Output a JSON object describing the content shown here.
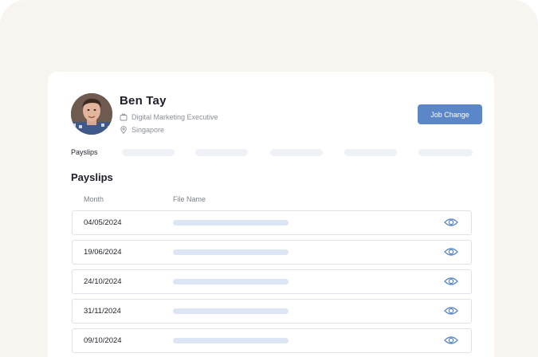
{
  "profile": {
    "name": "Ben Tay",
    "job_title": "Digital Marketing Executive",
    "location": "Singapore"
  },
  "actions": {
    "job_change_label": "Job Change"
  },
  "tabs": {
    "active_label": "Payslips"
  },
  "payslips": {
    "title": "Payslips",
    "columns": {
      "month": "Month",
      "file_name": "File Name"
    },
    "rows": [
      {
        "month": "04/05/2024"
      },
      {
        "month": "19/06/2024"
      },
      {
        "month": "24/10/2024"
      },
      {
        "month": "31/11/2024"
      },
      {
        "month": "09/10/2024"
      }
    ]
  },
  "colors": {
    "accent": "#5b87c8",
    "background": "#f8f4f0",
    "placeholder": "#dbe5f4"
  },
  "icons": {
    "job": "briefcase-icon",
    "location": "location-pin-icon",
    "view": "eye-icon"
  }
}
